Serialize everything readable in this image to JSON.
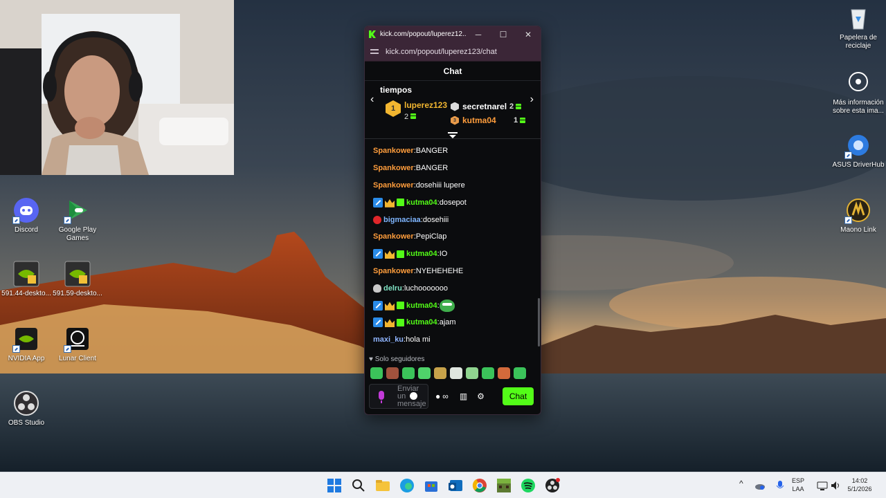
{
  "window": {
    "title": "kick.com/popout/luperez12...",
    "minimize_label": "─",
    "maximize_label": "☐",
    "close_label": "✕",
    "url": "kick.com/popout/luperez123/chat"
  },
  "chat": {
    "header": "Chat",
    "leaderboard": {
      "heading": "tiempos",
      "prev_label": "‹",
      "next_label": "›",
      "first": {
        "rank": "1",
        "name": "luperez123",
        "count": "2"
      },
      "second": {
        "name": "secretnarel",
        "count": "2"
      },
      "third": {
        "rank": "3",
        "name": "kutma04",
        "count": "1"
      }
    },
    "messages": [
      {
        "user": "Spankower",
        "color": "#ff9d3c",
        "text": "BANGER",
        "badges": [],
        "emote": false
      },
      {
        "user": "Spankower",
        "color": "#ff9d3c",
        "text": "BANGER",
        "badges": [],
        "emote": false
      },
      {
        "user": "Spankower",
        "color": "#ff9d3c",
        "text": "dosehiii lupere",
        "badges": [],
        "emote": false
      },
      {
        "user": "kutma04",
        "color": "#53fc18",
        "text": "dosepot",
        "badges": [
          "mod",
          "crown",
          "gift-b"
        ],
        "emote": false
      },
      {
        "user": "bigmaciaa",
        "color": "#7fb6ff",
        "text": "dosehiii",
        "badges": [
          "red"
        ],
        "emote": false
      },
      {
        "user": "Spankower",
        "color": "#ff9d3c",
        "text": "PepiClap",
        "badges": [],
        "emote": false
      },
      {
        "user": "kutma04",
        "color": "#53fc18",
        "text": "IO",
        "badges": [
          "mod",
          "crown",
          "gift-b"
        ],
        "emote": false
      },
      {
        "user": "Spankower",
        "color": "#ff9d3c",
        "text": "NYEHEHEHE",
        "badges": [],
        "emote": false
      },
      {
        "user": "delru",
        "color": "#7fe3c4",
        "text": "luchooooooo",
        "badges": [
          "mask"
        ],
        "emote": false
      },
      {
        "user": "kutma04",
        "color": "#53fc18",
        "text": "",
        "badges": [
          "mod",
          "crown",
          "gift-b"
        ],
        "emote": true
      },
      {
        "user": "kutma04",
        "color": "#53fc18",
        "text": "ajam",
        "badges": [
          "mod",
          "crown",
          "gift-b"
        ],
        "emote": false
      },
      {
        "user": "maxi_ku",
        "color": "#8fb4ff",
        "text": "hola mi",
        "badges": [],
        "emote": false
      }
    ],
    "followers_only": "♥ Solo seguidores",
    "input_placeholder": "Enviar un mensaje",
    "chat_button": "Chat",
    "infinity_label": "∞",
    "settings_label": "⚙"
  },
  "desktop_icons": [
    {
      "label": "Papelera de reciclaje",
      "icon": "recycle-bin-icon"
    },
    {
      "label": "Más información sobre esta ima...",
      "icon": "info-icon"
    },
    {
      "label": "ASUS DriverHub",
      "icon": "asus-driverhub-icon"
    },
    {
      "label": "Maono Link",
      "icon": "maono-link-icon"
    },
    {
      "label": "Discord",
      "icon": "discord-icon"
    },
    {
      "label": "Google Play Games",
      "icon": "google-play-games-icon"
    },
    {
      "label": "591.44-deskto...",
      "icon": "nvidia-installer-icon"
    },
    {
      "label": "591.59-deskto...",
      "icon": "nvidia-installer-icon"
    },
    {
      "label": "NVIDIA App",
      "icon": "nvidia-app-icon"
    },
    {
      "label": "Lunar Client",
      "icon": "lunar-client-icon"
    },
    {
      "label": "OBS Studio",
      "icon": "obs-studio-icon"
    }
  ],
  "taskbar": {
    "language": "ESP",
    "layout": "LAA",
    "time": "14:02",
    "date": "5/1/2026",
    "chevron": "^"
  }
}
